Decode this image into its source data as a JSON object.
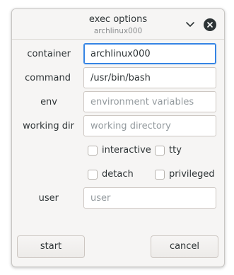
{
  "dialog": {
    "title": "exec options",
    "subtitle": "archlinux000"
  },
  "fields": {
    "container": {
      "label": "container",
      "value": "archlinux000",
      "placeholder": ""
    },
    "command": {
      "label": "command",
      "value": "/usr/bin/bash",
      "placeholder": ""
    },
    "env": {
      "label": "env",
      "value": "",
      "placeholder": "environment variables"
    },
    "working_dir": {
      "label": "working dir",
      "value": "",
      "placeholder": "working directory"
    },
    "user": {
      "label": "user",
      "value": "",
      "placeholder": "user"
    }
  },
  "options": {
    "interactive": {
      "label": "interactive",
      "checked": false
    },
    "tty": {
      "label": "tty",
      "checked": false
    },
    "detach": {
      "label": "detach",
      "checked": false
    },
    "privileged": {
      "label": "privileged",
      "checked": false
    }
  },
  "buttons": {
    "start": "start",
    "cancel": "cancel"
  },
  "icons": {
    "menu": "chevron-down-icon",
    "close": "close-icon"
  },
  "colors": {
    "accent": "#3584e4",
    "window_bg": "#f6f5f4",
    "text": "#2e3436"
  }
}
